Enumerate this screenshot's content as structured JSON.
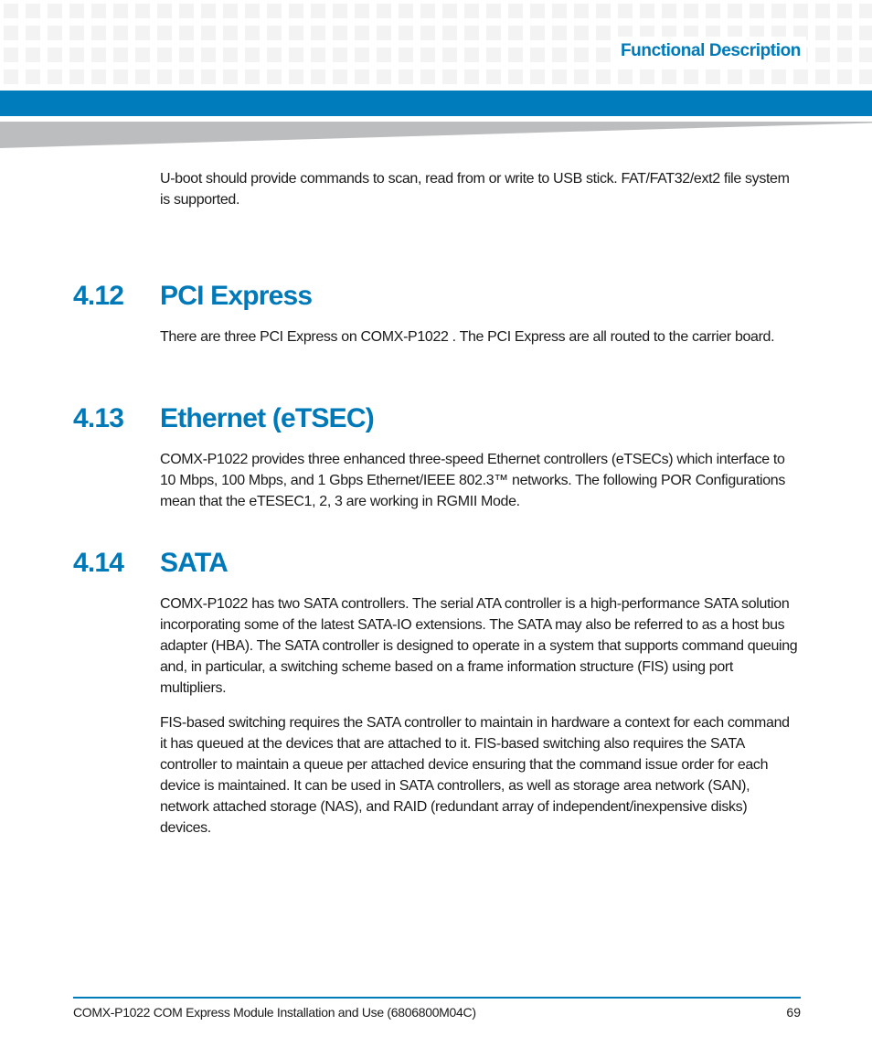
{
  "header": {
    "section_title": "Functional Description",
    "accent_color": "#007bbb"
  },
  "intro": {
    "text": "U-boot should provide commands to scan, read from or write to USB stick. FAT/FAT32/ext2 file system is supported."
  },
  "sections": [
    {
      "number": "4.12",
      "title": "PCI Express",
      "paragraphs": [
        "There are three PCI Express on COMX-P1022 . The PCI Express are all routed to the carrier board."
      ]
    },
    {
      "number": "4.13",
      "title": "Ethernet (eTSEC)",
      "paragraphs": [
        "COMX-P1022 provides three enhanced three-speed Ethernet controllers (eTSECs) which interface to 10 Mbps, 100 Mbps, and 1 Gbps Ethernet/IEEE 802.3™ networks. The following POR Configurations mean that the eTESEC1, 2, 3 are working in RGMII Mode."
      ]
    },
    {
      "number": "4.14",
      "title": "SATA",
      "paragraphs": [
        "COMX-P1022 has two SATA controllers. The serial ATA controller is a high-performance SATA solution incorporating some of the latest SATA-IO extensions. The SATA may also be referred to as a host bus adapter (HBA). The SATA controller is designed to operate in a system that supports command queuing and, in particular, a switching scheme based on a frame information structure (FIS) using port multipliers.",
        "FIS-based switching requires the SATA controller to maintain in hardware a context for each command it has queued at the devices that are attached to it. FIS-based switching also requires the SATA controller to maintain a queue per attached device ensuring that the command issue order for each device is maintained. It can be used in SATA controllers, as well as storage area network (SAN), network attached storage (NAS), and RAID (redundant array of independent/inexpensive disks) devices."
      ]
    }
  ],
  "footer": {
    "document_title": "COMX-P1022 COM Express Module Installation and Use (6806800M04C)",
    "page_number": "69"
  }
}
